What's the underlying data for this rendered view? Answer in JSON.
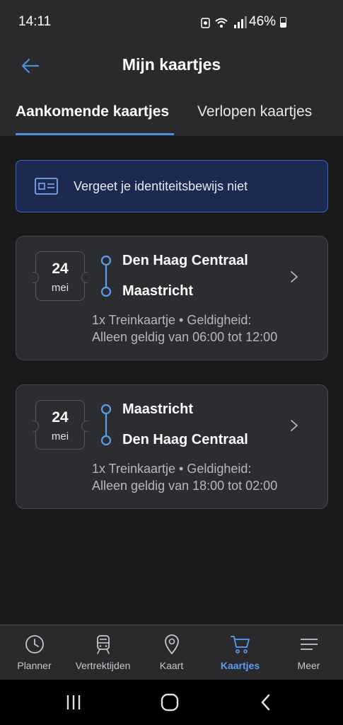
{
  "status_bar": {
    "time": "14:11",
    "battery_pct": "46%"
  },
  "header": {
    "title": "Mijn kaartjes",
    "back_icon": "arrow-left-icon"
  },
  "tabs": [
    {
      "label": "Aankomende kaartjes",
      "active": true
    },
    {
      "label": "Verlopen kaartjes",
      "active": false
    }
  ],
  "banner": {
    "text": "Vergeet je identiteitsbewijs niet",
    "icon": "id-card-icon"
  },
  "tickets": [
    {
      "day": "24",
      "month": "mei",
      "from": "Den Haag Centraal",
      "to": "Maastricht",
      "desc_line1": "1x Treinkaartje • Geldigheid:",
      "desc_line2": "Alleen geldig van 06:00 tot 12:00"
    },
    {
      "day": "24",
      "month": "mei",
      "from": "Maastricht",
      "to": "Den Haag Centraal",
      "desc_line1": "1x Treinkaartje • Geldigheid:",
      "desc_line2": "Alleen geldig van 18:00 tot 02:00"
    }
  ],
  "bottom_nav": [
    {
      "label": "Planner",
      "icon": "clock-icon",
      "active": false
    },
    {
      "label": "Vertrektijden",
      "icon": "train-icon",
      "active": false
    },
    {
      "label": "Kaart",
      "icon": "map-pin-icon",
      "active": false
    },
    {
      "label": "Kaartjes",
      "icon": "cart-icon",
      "active": true
    },
    {
      "label": "Meer",
      "icon": "menu-icon",
      "active": false
    }
  ],
  "colors": {
    "accent": "#4a8fe0",
    "active_nav": "#5a9cf0",
    "background": "#1a1a1c",
    "surface": "#2c2d30",
    "banner_bg": "#1c2a52"
  }
}
